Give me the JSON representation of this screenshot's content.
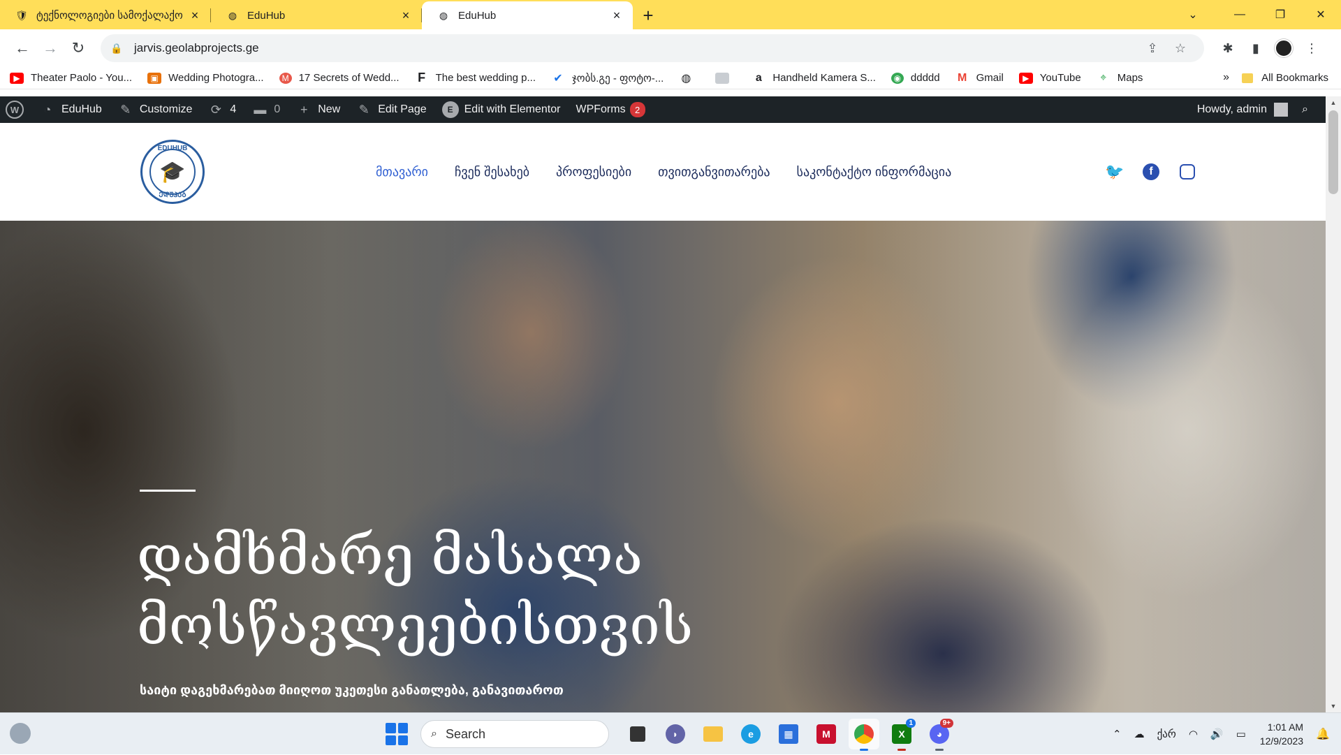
{
  "browser": {
    "tabs": [
      {
        "title": "ტექნოლოგიები სამოქალაქო",
        "favicon": "shield-icon",
        "active": false
      },
      {
        "title": "EduHub",
        "favicon": "globe-icon",
        "active": false
      },
      {
        "title": "EduHub",
        "favicon": "globe-icon",
        "active": true
      }
    ],
    "url": "jarvis.geolabprojects.ge",
    "bookmarks": [
      {
        "label": "Theater Paolo - You...",
        "icon": "youtube-icon",
        "color": "#ff0000"
      },
      {
        "label": "Wedding Photogra...",
        "icon": "photo-icon",
        "color": "#e8710a"
      },
      {
        "label": "17 Secrets of Wedd...",
        "icon": "mf-icon",
        "color": "#e8584a"
      },
      {
        "label": "The best wedding p...",
        "icon": "f-letter-icon",
        "color": "#202124"
      },
      {
        "label": "ჯობს.გე - ფოტო-...",
        "icon": "check-icon",
        "color": "#1a73e8"
      },
      {
        "label": "",
        "icon": "globe-icon",
        "color": "#202124"
      },
      {
        "label": "",
        "icon": "image-icon",
        "color": "#9aa0a6"
      },
      {
        "label": "Handheld Kamera S...",
        "icon": "amazon-icon",
        "color": "#202124"
      },
      {
        "label": "ddddd",
        "icon": "eye-icon",
        "color": "#34a853"
      },
      {
        "label": "Gmail",
        "icon": "gmail-icon",
        "color": "#ea4335"
      },
      {
        "label": "YouTube",
        "icon": "youtube-icon",
        "color": "#ff0000"
      },
      {
        "label": "Maps",
        "icon": "maps-icon",
        "color": "#34a853"
      }
    ],
    "bookmarks_more": "»",
    "all_bookmarks": "All Bookmarks"
  },
  "wpbar": {
    "site_name": "EduHub",
    "customize": "Customize",
    "updates_count": "4",
    "comments_count": "0",
    "new_label": "New",
    "edit_page": "Edit Page",
    "elementor": "Edit with Elementor",
    "wpforms": "WPForms",
    "wpforms_badge": "2",
    "howdy": "Howdy, admin"
  },
  "site": {
    "logo_top": "EDUHUB",
    "logo_bottom": "ᲔᲓᲣᲰᲐᲑ",
    "nav": [
      {
        "label": "მთავარი",
        "current": true
      },
      {
        "label": "ჩვენ შესახებ",
        "current": false
      },
      {
        "label": "პროფესიები",
        "current": false
      },
      {
        "label": "თვითგანვითარება",
        "current": false
      },
      {
        "label": "საკონტაქტო ინფორმაცია",
        "current": false
      }
    ],
    "social": [
      "twitter-icon",
      "facebook-icon",
      "instagram-icon"
    ]
  },
  "hero": {
    "title_line1": "დამხმარე მასალა",
    "title_line2": "მოსწავლეებისთვის",
    "subtitle": "საიტი დაგეხმარებათ  მიიღოთ უკეთესი განათლება, განავითაროთ"
  },
  "taskbar": {
    "search_placeholder": "Search",
    "lang": "ქარ",
    "time": "1:01 AM",
    "date": "12/9/2023",
    "xbox_badge": "1",
    "discord_badge": "9+"
  }
}
